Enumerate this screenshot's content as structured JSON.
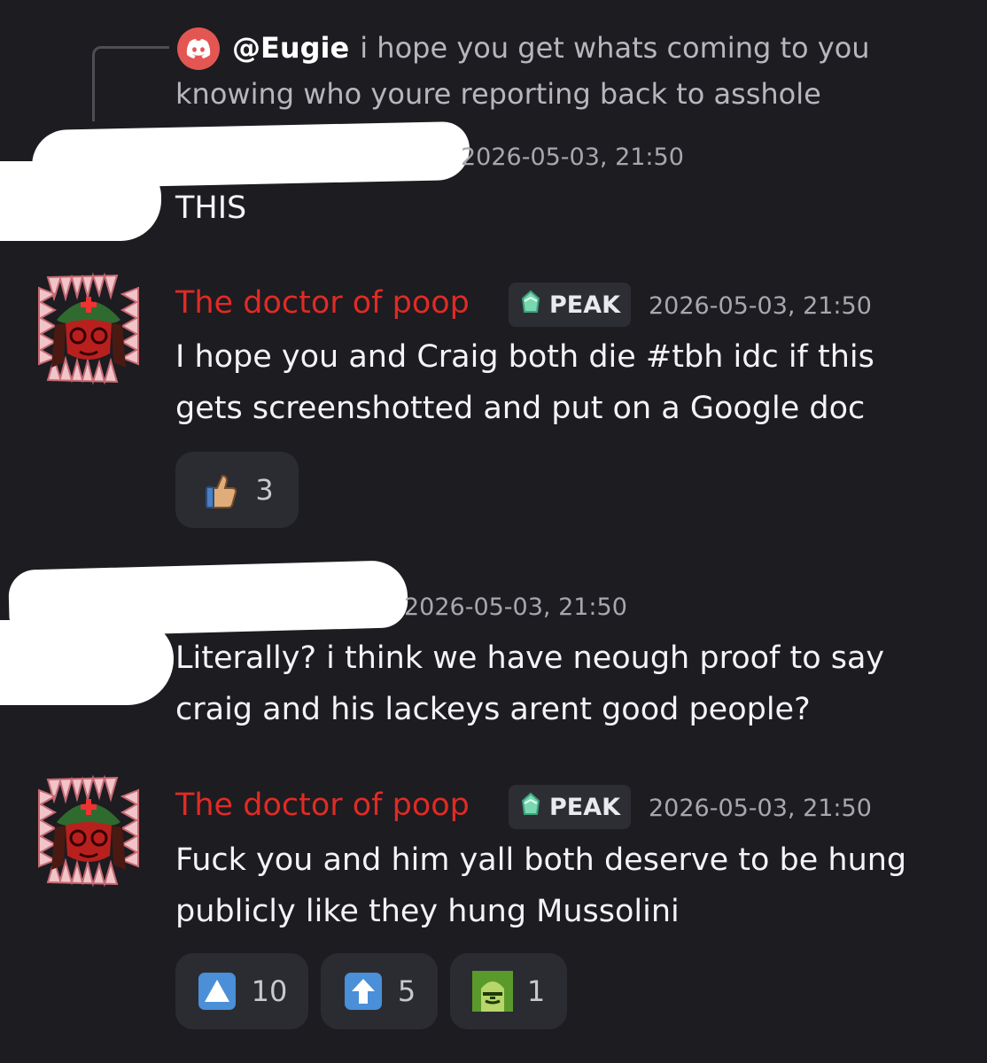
{
  "reply": {
    "author": "@Eugie",
    "text": "i hope you get whats coming to you knowing who youre reporting back to asshole",
    "icon": "discord-icon"
  },
  "messages": [
    {
      "author_redacted": true,
      "timestamp": "2026-05-03, 21:50",
      "text": "THIS"
    },
    {
      "author": "The doctor of poop",
      "badge": "PEAK",
      "timestamp": "2026-05-03, 21:50",
      "text": "I hope you and Craig both die #tbh idc if this gets screenshotted and put on a Google doc",
      "reactions": [
        {
          "emoji": "thumbs-up-icon",
          "count": "3"
        }
      ]
    },
    {
      "author_redacted": true,
      "timestamp": "2026-05-03, 21:50",
      "text": "Literally? i think we have neough proof to say craig and his lackeys arent good people?"
    },
    {
      "author": "The doctor of poop",
      "badge": "PEAK",
      "timestamp": "2026-05-03, 21:50",
      "text": "Fuck you and him yall both deserve to be hung publicly like they hung Mussolini",
      "reactions": [
        {
          "emoji": "up-triangle-icon",
          "count": "10"
        },
        {
          "emoji": "up-arrow-icon",
          "count": "5"
        },
        {
          "emoji": "custom-face-emoji-icon",
          "count": "1"
        }
      ]
    }
  ],
  "colors": {
    "background": "#1c1c21",
    "author_red": "#e02b24",
    "timestamp": "#a7a8ae",
    "reaction_bg": "#2b2c31"
  }
}
